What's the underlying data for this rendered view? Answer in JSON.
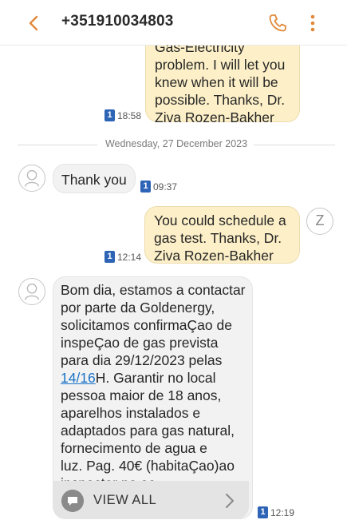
{
  "header": {
    "title": "+351910034803",
    "back_icon": "chevron-left-icon",
    "call_icon": "phone-icon",
    "menu_icon": "more-vertical-icon",
    "accent_color": "#e08a3c"
  },
  "messages": [
    {
      "direction": "sent",
      "lines": [
        "Gas-Electricity",
        "problem. I will let you",
        "knew when it will be",
        "possible. Thanks, Dr.",
        "Ziva Rozen-Bakher"
      ],
      "sim": "1",
      "time": "18:58"
    },
    {
      "direction": "received",
      "lines": [
        "Thank you"
      ],
      "sim": "1",
      "time": "09:37"
    },
    {
      "direction": "sent",
      "lines": [
        "You could schedule a",
        "gas test. Thanks, Dr.",
        "Ziva Rozen-Bakher"
      ],
      "sim": "1",
      "time": "12:14",
      "avatar_letter": "Z"
    },
    {
      "direction": "received",
      "lines": [
        "Bom dia, estamos a contactar",
        "por parte da Goldenergy,",
        "solicitamos confirmaÇao de",
        "inspeÇao de gas prevista",
        "para dia 29/12/2023 pelas"
      ],
      "link_line": {
        "link": "14/16",
        "rest": "H. Garantir no local"
      },
      "lines_after": [
        "pessoa maior de 18 anos,",
        "aparelhos instalados e",
        "adaptados para gas natural,",
        "fornecimento de agua e",
        "luz. Pag. 40€ (habitaÇao)ao",
        "inspector no ac"
      ],
      "view_all_label": "VIEW ALL",
      "sim": "1",
      "time": "12:19"
    }
  ],
  "date_separator": "Wednesday, 27 December 2023"
}
